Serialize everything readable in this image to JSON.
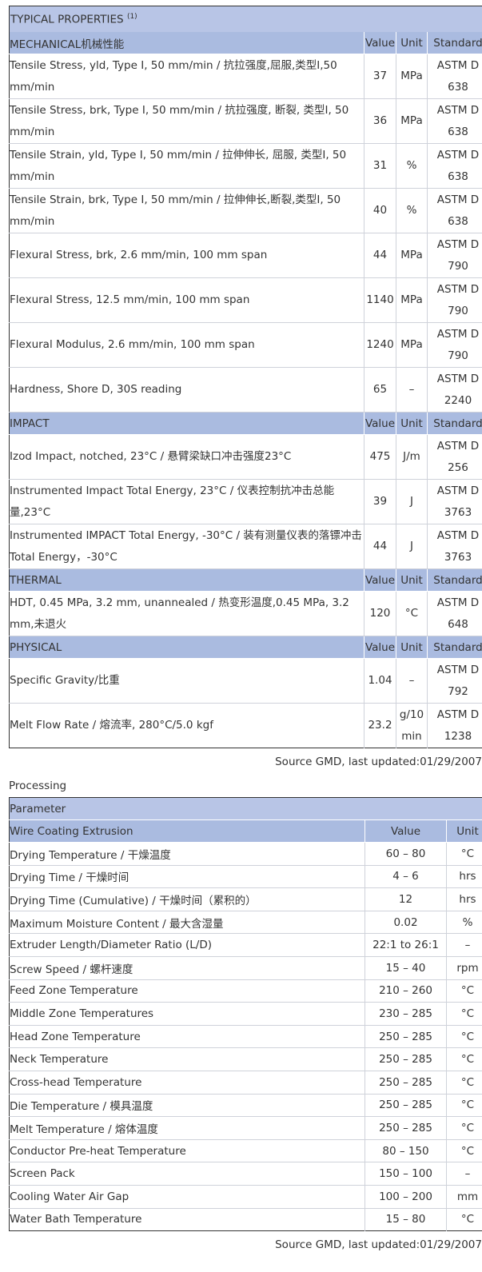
{
  "typical": {
    "title": "TYPICAL PROPERTIES",
    "title_sup": "(1)",
    "sections": [
      {
        "name": "MECHANICAL机械性能",
        "col_value": "Value",
        "col_unit": "Unit",
        "col_standard": "Standard",
        "rows": [
          {
            "name": "Tensile Stress, yld, Type I, 50 mm/min / 抗拉强度,屈服,类型I,50 mm/min",
            "value": "37",
            "unit": "MPa",
            "standard": "ASTM D 638"
          },
          {
            "name": "Tensile Stress, brk, Type I, 50 mm/min / 抗拉强度, 断裂, 类型I, 50 mm/min",
            "value": "36",
            "unit": "MPa",
            "standard": "ASTM D 638"
          },
          {
            "name": "Tensile Strain, yld, Type I, 50 mm/min / 拉伸伸长, 屈服, 类型I, 50 mm/min",
            "value": "31",
            "unit": "%",
            "standard": "ASTM D 638"
          },
          {
            "name": "Tensile Strain, brk, Type I, 50 mm/min / 拉伸伸长,断裂,类型I, 50 mm/min",
            "value": "40",
            "unit": "%",
            "standard": "ASTM D 638"
          },
          {
            "name": "Flexural Stress, brk, 2.6 mm/min, 100 mm span",
            "value": "44",
            "unit": "MPa",
            "standard": "ASTM D 790"
          },
          {
            "name": "Flexural Stress, 12.5 mm/min, 100 mm span",
            "value": "1140",
            "unit": "MPa",
            "standard": "ASTM D 790"
          },
          {
            "name": "Flexural Modulus, 2.6 mm/min, 100 mm span",
            "value": "1240",
            "unit": "MPa",
            "standard": "ASTM D 790"
          },
          {
            "name": "Hardness, Shore D, 30S reading",
            "value": "65",
            "unit": "–",
            "standard": "ASTM D 2240"
          }
        ]
      },
      {
        "name": "IMPACT",
        "col_value": "Value",
        "col_unit": "Unit",
        "col_standard": "Standard",
        "rows": [
          {
            "name": "Izod Impact, notched, 23°C / 悬臂梁缺口冲击强度23°C",
            "value": "475",
            "unit": "J/m",
            "standard": "ASTM D 256"
          },
          {
            "name": "Instrumented Impact Total Energy, 23°C / 仪表控制抗冲击总能量,23°C",
            "value": "39",
            "unit": "J",
            "standard": "ASTM D 3763"
          },
          {
            "name": "Instrumented IMPACT Total Energy, -30°C / 装有测量仪表的落镖冲击Total Energy，-30°C",
            "value": "44",
            "unit": "J",
            "standard": "ASTM D 3763"
          }
        ]
      },
      {
        "name": "THERMAL",
        "col_value": "Value",
        "col_unit": "Unit",
        "col_standard": "Standard",
        "rows": [
          {
            "name": "HDT, 0.45 MPa, 3.2 mm, unannealed / 热变形温度,0.45 MPa, 3.2 mm,未退火",
            "value": "120",
            "unit": "°C",
            "standard": "ASTM D 648"
          }
        ]
      },
      {
        "name": "PHYSICAL",
        "col_value": "Value",
        "col_unit": "Unit",
        "col_standard": "Standard",
        "rows": [
          {
            "name": "Specific Gravity/比重",
            "value": "1.04",
            "unit": "–",
            "standard": "ASTM D 792"
          },
          {
            "name": "Melt Flow Rate / 熔流率, 280°C/5.0 kgf",
            "value": "23.2",
            "unit": "g/10 min",
            "standard": "ASTM D 1238"
          }
        ]
      }
    ],
    "source": "Source GMD, last updated:01/29/2007"
  },
  "processing": {
    "title": "Processing",
    "header": "Parameter",
    "section": "Wire Coating Extrusion",
    "col_value": "Value",
    "col_unit": "Unit",
    "rows": [
      {
        "name": "Drying Temperature / 干燥温度",
        "value": "60 – 80",
        "unit": "°C"
      },
      {
        "name": "Drying Time / 干燥时间",
        "value": "4 – 6",
        "unit": "hrs"
      },
      {
        "name": "Drying Time (Cumulative) / 干燥时间（累积的）",
        "value": "12",
        "unit": "hrs"
      },
      {
        "name": "Maximum Moisture Content / 最大含湿量",
        "value": "0.02",
        "unit": "%"
      },
      {
        "name": "Extruder Length/Diameter Ratio (L/D)",
        "value": "22:1 to 26:1",
        "unit": "–"
      },
      {
        "name": "Screw Speed / 螺杆速度",
        "value": "15 – 40",
        "unit": "rpm"
      },
      {
        "name": "Feed Zone Temperature",
        "value": "210 – 260",
        "unit": "°C"
      },
      {
        "name": "Middle Zone Temperatures",
        "value": "230 – 285",
        "unit": "°C"
      },
      {
        "name": "Head Zone Temperature",
        "value": "250 – 285",
        "unit": "°C"
      },
      {
        "name": "Neck Temperature",
        "value": "250 – 285",
        "unit": "°C"
      },
      {
        "name": "Cross-head Temperature",
        "value": "250 – 285",
        "unit": "°C"
      },
      {
        "name": "Die Temperature / 模具温度",
        "value": "250 – 285",
        "unit": "°C"
      },
      {
        "name": "Melt Temperature / 熔体温度",
        "value": "250 – 285",
        "unit": "°C"
      },
      {
        "name": "Conductor Pre-heat Temperature",
        "value": "80 – 150",
        "unit": "°C"
      },
      {
        "name": "Screen Pack",
        "value": "150 – 100",
        "unit": "–"
      },
      {
        "name": "Cooling Water Air Gap",
        "value": "100 – 200",
        "unit": "mm"
      },
      {
        "name": "Water Bath Temperature",
        "value": "15 – 80",
        "unit": "°C"
      }
    ],
    "source": "Source GMD, last updated:01/29/2007"
  }
}
